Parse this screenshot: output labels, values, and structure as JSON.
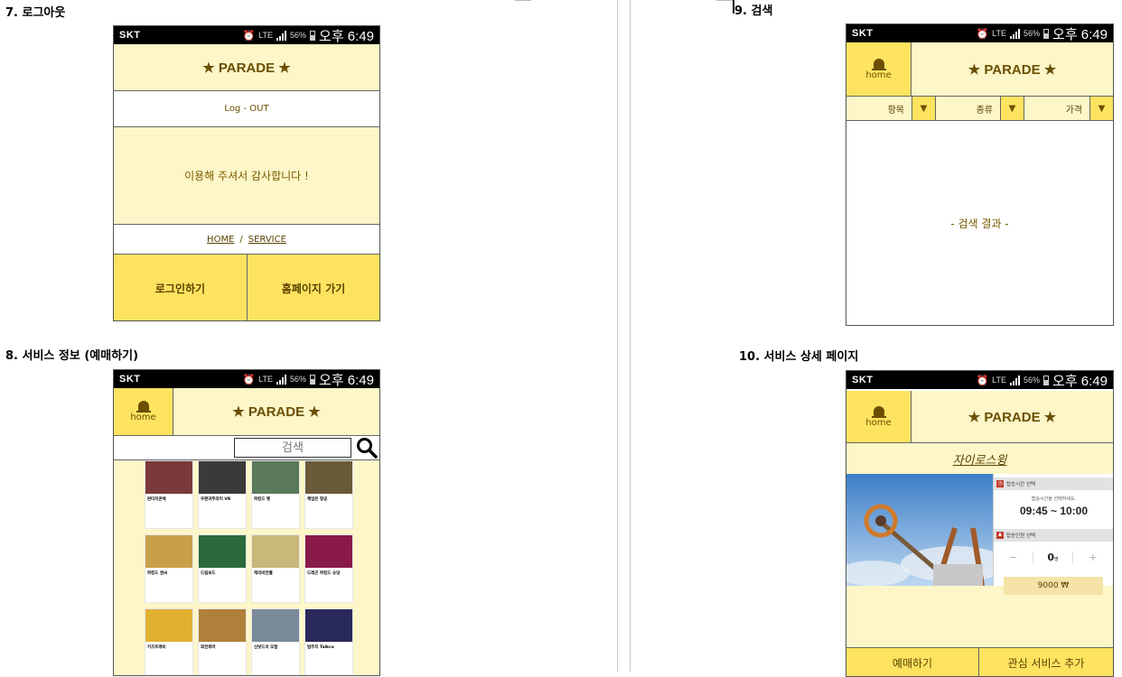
{
  "sections": {
    "s7": "7. 로그아웃",
    "s8": "8. 서비스 정보 (예매하기)",
    "s9": "9. 검색",
    "s10": "10. 서비스 상세 페이지"
  },
  "status_bar": {
    "carrier": "SKT",
    "network": "LTE",
    "battery": "56%",
    "time": "오후 6:49"
  },
  "brand": {
    "title": "★ PARADE ★",
    "home_label": "home"
  },
  "logout": {
    "log_out": "Log  -  OUT",
    "thanks": "이용해 주셔서 감사합니다 !",
    "home_link": "HOME",
    "separator": "/",
    "service_link": "SERVICE",
    "login_button": "로그인하기",
    "homepage_button": "홈페이지 가기"
  },
  "service_info": {
    "search_placeholder": "검색",
    "cards": [
      {
        "title": "판타지콘체",
        "thumb": "#7a3a3a"
      },
      {
        "title": "우편귀뚜라미 VR",
        "thumb": "#3a3a3a"
      },
      {
        "title": "파킹드 펫",
        "thumb": "#5a7a5a"
      },
      {
        "title": "헤엄은 항공",
        "thumb": "#6a5a3a"
      },
      {
        "title": "파킹드 앤씨",
        "thumb": "#c8a04a"
      },
      {
        "title": "드림보드",
        "thumb": "#2a6a3a"
      },
      {
        "title": "캐리비언벨",
        "thumb": "#c8b87a"
      },
      {
        "title": "드래곤 파킹드 슈덩",
        "thumb": "#8a1a4a"
      },
      {
        "title": "키즈트래비",
        "thumb": "#e0b030"
      },
      {
        "title": "회전목마",
        "thumb": "#b0803a"
      },
      {
        "title": "신밧드의 모험",
        "thumb": "#7a8a9a"
      },
      {
        "title": "범주지 Talkco",
        "thumb": "#2a2a5a"
      }
    ]
  },
  "search": {
    "filters": [
      {
        "label": "항목"
      },
      {
        "label": "종류"
      },
      {
        "label": "가격"
      }
    ],
    "result_text": "- 검색 결과 -"
  },
  "detail": {
    "ride_name": "자이로스윙",
    "time_select_label": "탑승시간 선택",
    "time_hint": "탑승시간을 선택하세요.",
    "time_range": "09:45 ~ 10:00",
    "people_select_label": "탑승인원 선택",
    "minus": "−",
    "count": "0",
    "count_unit": "명",
    "plus": "+",
    "price": "9000 ₩",
    "reserve_button": "예매하기",
    "interest_button": "관심 서비스 추가"
  },
  "colors": {
    "cream": "#fdf6c8",
    "yellow": "#fde360",
    "brand_text": "#6b4f00"
  }
}
